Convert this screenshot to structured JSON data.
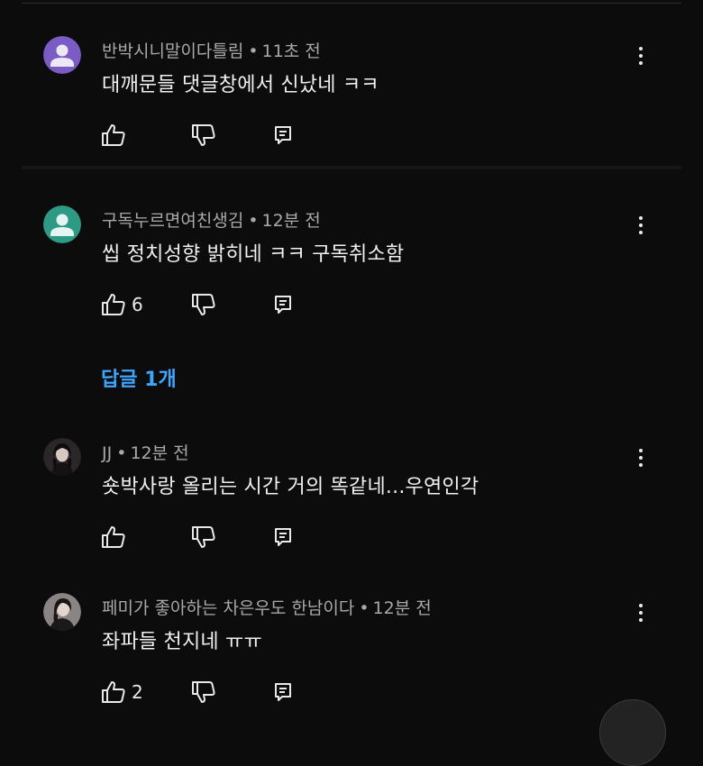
{
  "comments": [
    {
      "author": "반박시니말이다틀림",
      "time": "11초 전",
      "text": "대깨문들 댓글창에서 신났네 ㅋㅋ",
      "like_count": "",
      "avatar_color": "#7b5cc4"
    },
    {
      "author": "구독누르면여친생김",
      "time": "12분 전",
      "text": "씹 정치성향 밝히네 ㅋㅋ 구독취소함",
      "like_count": "6",
      "avatar_color": "#2e9a86",
      "replies_label": "답글 1개"
    },
    {
      "author": "JJ",
      "time": "12분 전",
      "text": "숏박사랑 올리는 시간 거의 똑같네...우연인각",
      "like_count": ""
    },
    {
      "author": "페미가 좋아하는 차은우도 한남이다",
      "time": "12분 전",
      "text": "좌파들 천지네 ㅠㅠ",
      "like_count": "2"
    }
  ],
  "separator": "•",
  "icons": {
    "like": "thumbs-up-icon",
    "dislike": "thumbs-down-icon",
    "reply": "reply-icon",
    "menu": "more-vert-icon"
  },
  "colors": {
    "background": "#0c0c0c",
    "link": "#3ea6ff",
    "meta_text": "#a9a9a9"
  }
}
